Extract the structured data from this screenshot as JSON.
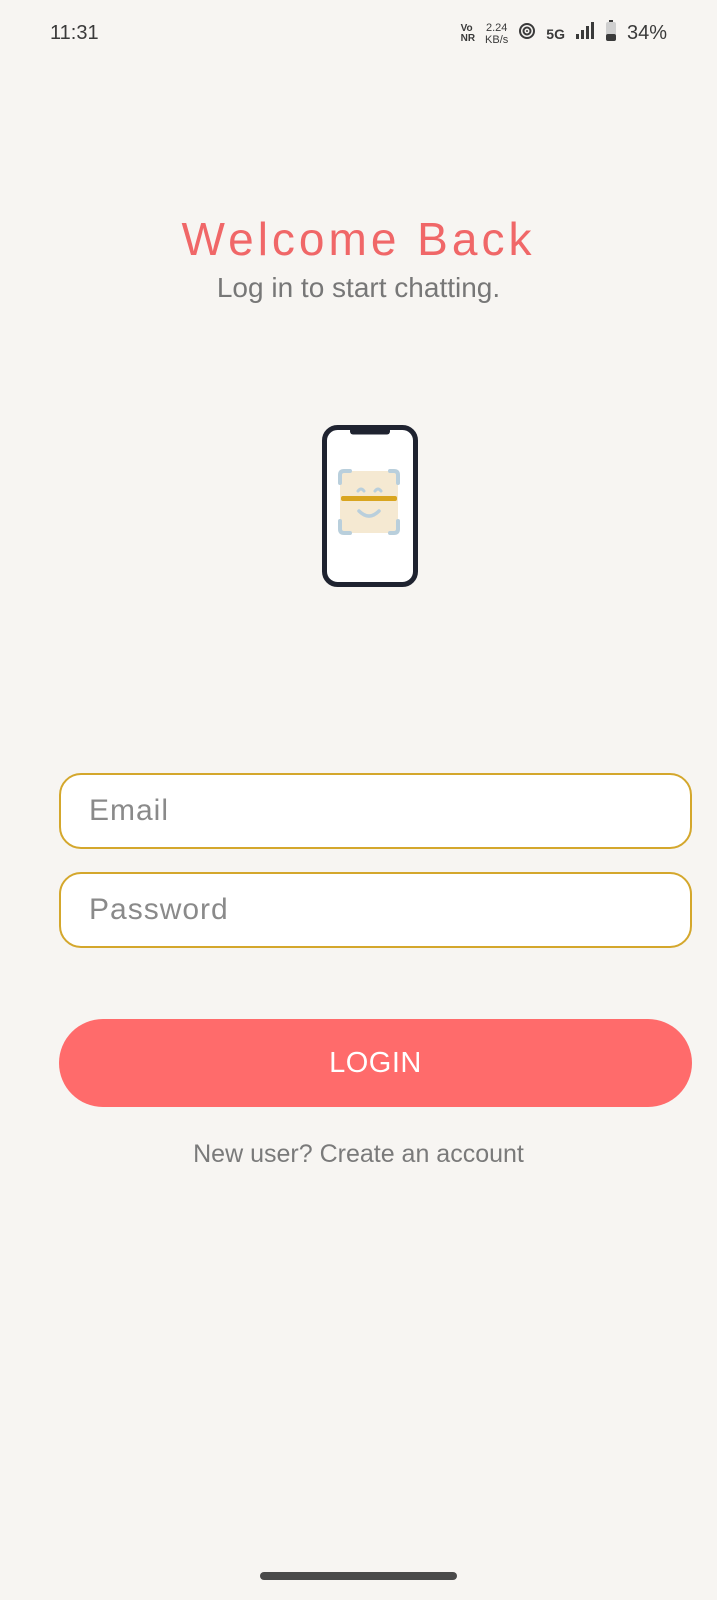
{
  "status_bar": {
    "time": "11:31",
    "vonr_top": "Vo",
    "vonr_bottom": "NR",
    "speed_value": "2.24",
    "speed_unit": "KB/s",
    "network": "5G",
    "battery": "34%"
  },
  "header": {
    "title": "Welcome Back",
    "subtitle": "Log in to start chatting."
  },
  "illustration": {
    "icon": "phone-face-scan-icon",
    "colors": {
      "frame": "#1f2330",
      "face_box": "#f5e9d2",
      "scan_line": "#d9a51f",
      "brackets": "#b9cfdc"
    }
  },
  "form": {
    "email_placeholder": "Email",
    "password_placeholder": "Password",
    "login_label": "LOGIN",
    "signup_link": "New user? Create an account"
  },
  "colors": {
    "background": "#f7f5f2",
    "accent": "#ff6b6b",
    "title": "#f06768",
    "input_border": "#d4a72c"
  }
}
